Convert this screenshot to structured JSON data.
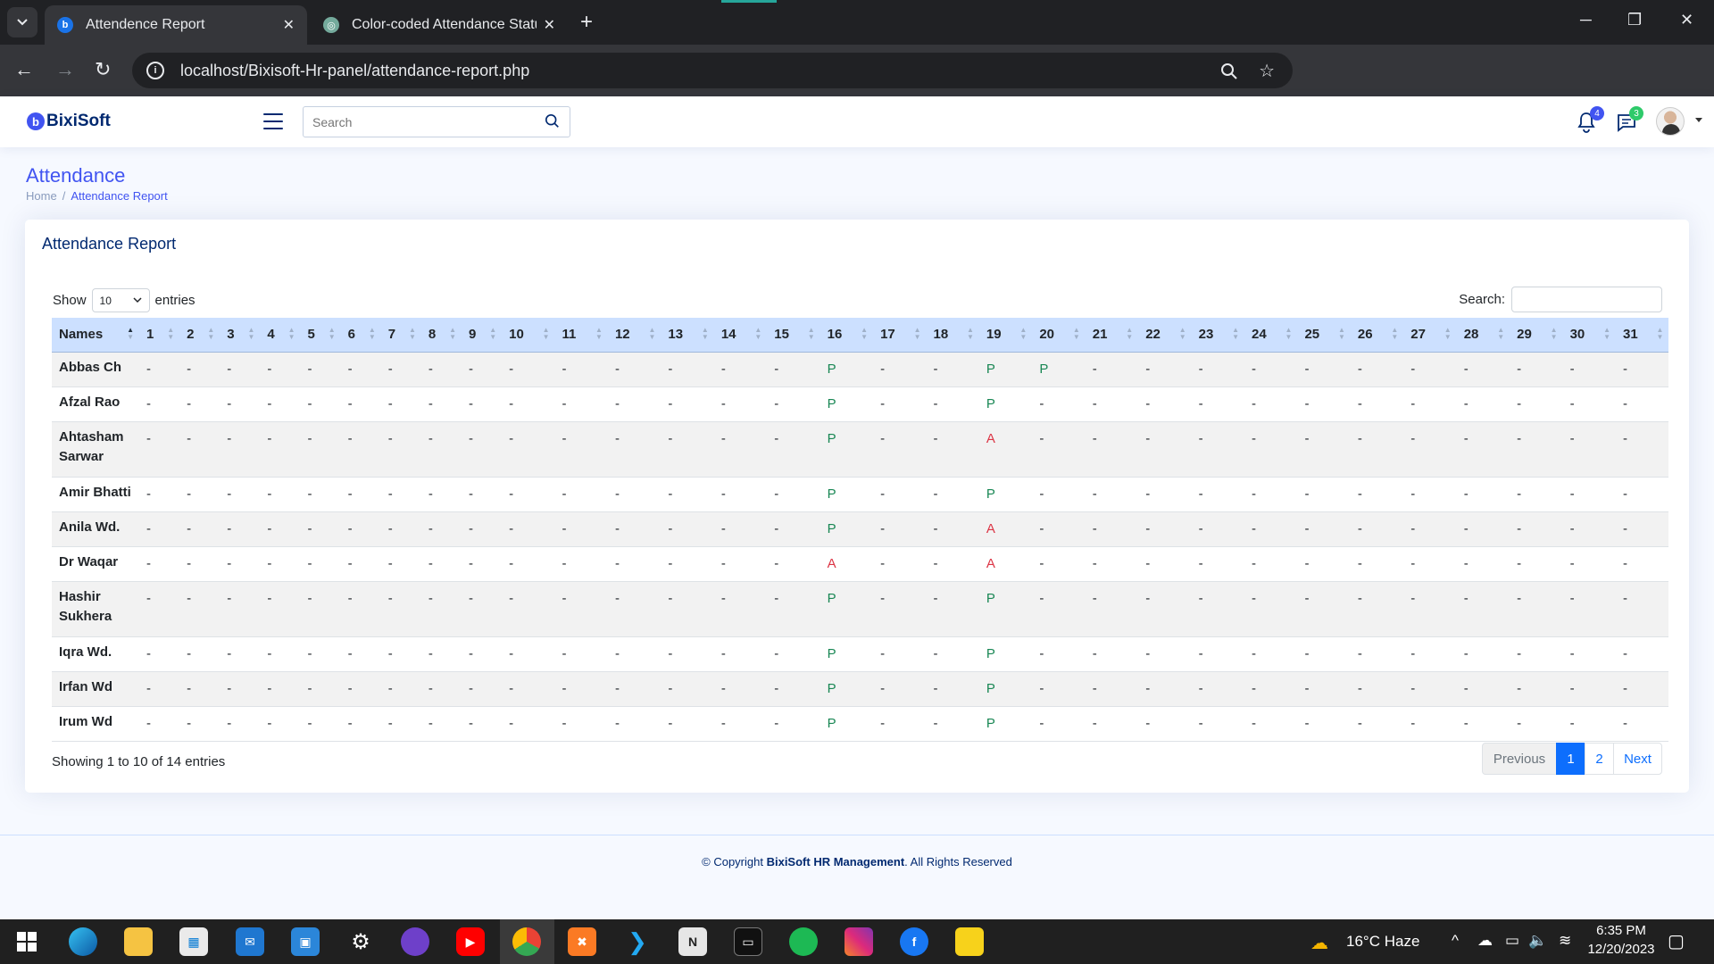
{
  "browser": {
    "tabs": [
      {
        "label": "Attendence Report",
        "active": true
      },
      {
        "label": "Color-coded Attendance Status",
        "active": false
      }
    ],
    "url": "localhost/Bixisoft-Hr-panel/attendance-report.php",
    "new_tab": "+",
    "window_controls": {
      "minimize": "─",
      "restore": "❐",
      "close": "✕"
    }
  },
  "header": {
    "logo_text": "BixiSoft",
    "logo_mark": "b",
    "search_placeholder": "Search",
    "notifications_count": "4",
    "messages_count": "3"
  },
  "page": {
    "title": "Attendance",
    "breadcrumb": [
      "Home",
      "Attendance Report"
    ],
    "breadcrumb_sep": "/"
  },
  "card": {
    "title": "Attendance Report",
    "length_show": "Show",
    "length_value": "10",
    "length_entries": "entries",
    "search_label": "Search:",
    "columns": [
      "Names",
      "1",
      "2",
      "3",
      "4",
      "5",
      "6",
      "7",
      "8",
      "9",
      "10",
      "11",
      "12",
      "13",
      "14",
      "15",
      "16",
      "17",
      "18",
      "19",
      "20",
      "21",
      "22",
      "23",
      "24",
      "25",
      "26",
      "27",
      "28",
      "29",
      "30",
      "31"
    ],
    "rows": [
      {
        "name": "Abbas Ch",
        "days": [
          "-",
          "-",
          "-",
          "-",
          "-",
          "-",
          "-",
          "-",
          "-",
          "-",
          "-",
          "-",
          "-",
          "-",
          "-",
          "P",
          "-",
          "-",
          "P",
          "P",
          "-",
          "-",
          "-",
          "-",
          "-",
          "-",
          "-",
          "-",
          "-",
          "-",
          "-"
        ]
      },
      {
        "name": "Afzal Rao",
        "days": [
          "-",
          "-",
          "-",
          "-",
          "-",
          "-",
          "-",
          "-",
          "-",
          "-",
          "-",
          "-",
          "-",
          "-",
          "-",
          "P",
          "-",
          "-",
          "P",
          "-",
          "-",
          "-",
          "-",
          "-",
          "-",
          "-",
          "-",
          "-",
          "-",
          "-",
          "-"
        ]
      },
      {
        "name": "Ahtasham Sarwar",
        "days": [
          "-",
          "-",
          "-",
          "-",
          "-",
          "-",
          "-",
          "-",
          "-",
          "-",
          "-",
          "-",
          "-",
          "-",
          "-",
          "P",
          "-",
          "-",
          "A",
          "-",
          "-",
          "-",
          "-",
          "-",
          "-",
          "-",
          "-",
          "-",
          "-",
          "-",
          "-"
        ]
      },
      {
        "name": "Amir Bhatti",
        "days": [
          "-",
          "-",
          "-",
          "-",
          "-",
          "-",
          "-",
          "-",
          "-",
          "-",
          "-",
          "-",
          "-",
          "-",
          "-",
          "P",
          "-",
          "-",
          "P",
          "-",
          "-",
          "-",
          "-",
          "-",
          "-",
          "-",
          "-",
          "-",
          "-",
          "-",
          "-"
        ]
      },
      {
        "name": "Anila Wd.",
        "days": [
          "-",
          "-",
          "-",
          "-",
          "-",
          "-",
          "-",
          "-",
          "-",
          "-",
          "-",
          "-",
          "-",
          "-",
          "-",
          "P",
          "-",
          "-",
          "A",
          "-",
          "-",
          "-",
          "-",
          "-",
          "-",
          "-",
          "-",
          "-",
          "-",
          "-",
          "-"
        ]
      },
      {
        "name": "Dr Waqar",
        "days": [
          "-",
          "-",
          "-",
          "-",
          "-",
          "-",
          "-",
          "-",
          "-",
          "-",
          "-",
          "-",
          "-",
          "-",
          "-",
          "A",
          "-",
          "-",
          "A",
          "-",
          "-",
          "-",
          "-",
          "-",
          "-",
          "-",
          "-",
          "-",
          "-",
          "-",
          "-"
        ]
      },
      {
        "name": "Hashir Sukhera",
        "days": [
          "-",
          "-",
          "-",
          "-",
          "-",
          "-",
          "-",
          "-",
          "-",
          "-",
          "-",
          "-",
          "-",
          "-",
          "-",
          "P",
          "-",
          "-",
          "P",
          "-",
          "-",
          "-",
          "-",
          "-",
          "-",
          "-",
          "-",
          "-",
          "-",
          "-",
          "-"
        ]
      },
      {
        "name": "Iqra Wd.",
        "days": [
          "-",
          "-",
          "-",
          "-",
          "-",
          "-",
          "-",
          "-",
          "-",
          "-",
          "-",
          "-",
          "-",
          "-",
          "-",
          "P",
          "-",
          "-",
          "P",
          "-",
          "-",
          "-",
          "-",
          "-",
          "-",
          "-",
          "-",
          "-",
          "-",
          "-",
          "-"
        ]
      },
      {
        "name": "Irfan Wd",
        "days": [
          "-",
          "-",
          "-",
          "-",
          "-",
          "-",
          "-",
          "-",
          "-",
          "-",
          "-",
          "-",
          "-",
          "-",
          "-",
          "P",
          "-",
          "-",
          "P",
          "-",
          "-",
          "-",
          "-",
          "-",
          "-",
          "-",
          "-",
          "-",
          "-",
          "-",
          "-"
        ]
      },
      {
        "name": "Irum Wd",
        "days": [
          "-",
          "-",
          "-",
          "-",
          "-",
          "-",
          "-",
          "-",
          "-",
          "-",
          "-",
          "-",
          "-",
          "-",
          "-",
          "P",
          "-",
          "-",
          "P",
          "-",
          "-",
          "-",
          "-",
          "-",
          "-",
          "-",
          "-",
          "-",
          "-",
          "-",
          "-"
        ]
      }
    ],
    "info": "Showing 1 to 10 of 14 entries",
    "pagination": {
      "previous": "Previous",
      "pages": [
        "1",
        "2"
      ],
      "current": "1",
      "next": "Next"
    }
  },
  "footer": {
    "prefix": "© Copyright ",
    "brand": "BixiSoft HR Management",
    "suffix": ". All Rights Reserved"
  },
  "taskbar": {
    "weather": "16°C  Haze",
    "time": "6:35 PM",
    "date": "12/20/2023"
  },
  "colors": {
    "present": "#198754",
    "absent": "#dc3545",
    "primary": "#4154f1",
    "header_row": "#cce0ff"
  }
}
